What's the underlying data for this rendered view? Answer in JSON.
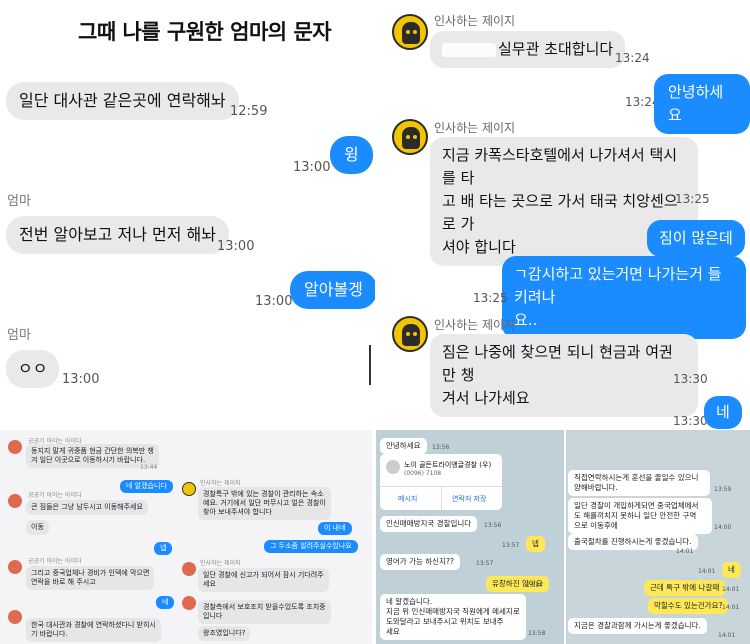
{
  "left_top": {
    "title": "그때 나를 구원한 엄마의 문자",
    "messages": [
      {
        "text": "일단 대사관 같은곳에 연락해놔",
        "time": "12:59"
      },
      {
        "text": "윙",
        "time": "13:00"
      },
      {
        "sender": "엄마",
        "text": "전번 알아보고 저나 먼저 해놔",
        "time": "13:00"
      },
      {
        "text": "알아볼겡",
        "time": "13:00"
      },
      {
        "sender": "엄마",
        "text": "ㅇㅇ",
        "time": "13:00"
      }
    ]
  },
  "right_top": {
    "sender_name": "인사하는 제이지",
    "messages": [
      {
        "text": "실무관 초대합니다",
        "time": "13:24"
      },
      {
        "text": "안녕하세요",
        "time": "13:24"
      },
      {
        "text_lines": [
          "지금 카폭스타호텔에서 나가셔서 택시를 타",
          "고 배 타는 곳으로 가서 태국 치앙센으로 가",
          "셔야 합니다"
        ],
        "time": "13:25"
      },
      {
        "text": "짐이 많은데",
        "time": ""
      },
      {
        "text_lines": [
          "ㄱ감시하고 있는거면 나가는거 들키려나",
          "요.."
        ],
        "time": "13:25"
      },
      {
        "text_lines": [
          "짐은 나중에 찾으면 되니 현금과 여권만 챙",
          "겨서 나가세요"
        ],
        "time": "13:30"
      },
      {
        "text": "네",
        "time": "13:30"
      }
    ]
  },
  "left_bottom": {
    "items": [
      {
        "name": "공공기 아이는 아이다",
        "text_lines": [
          "동지지 말게 귀중품 현금 간단한 의복만 챙",
          "겨 일단 이곳으로 이동하시기 바랍니다."
        ],
        "time": "13:44"
      },
      {
        "name": "인사하는 제이지",
        "text_lines": [
          "경찰특구 밖에 있는 경찰이 관리하는 속소",
          "예요. 거기에서 일단 머무시고 얼은 경찰이",
          "찾아 보내주셔야 합니다"
        ]
      },
      {
        "blue": "네 알겠습니다"
      },
      {
        "name": "공공기 아이는 아이다",
        "text_lines": [
          "큰 짐들은 그냥 남두시고 이동해주세요"
        ]
      },
      {
        "blue": "이 내네"
      },
      {
        "text": "이동"
      },
      {
        "blue": "그 두소좀 알려주실수있나요"
      },
      {
        "blue": "넵"
      },
      {
        "name": "공공기 아이는 아이다",
        "text_lines": [
          "그리고 중국업체나 경비가 인덱에 막으면",
          "연락을 바로 해 주시고"
        ]
      },
      {
        "name": "인사하는 제이지",
        "text_lines": [
          "일단 경찰에 신고가 되어서 잠시 기다려주",
          "세요"
        ]
      },
      {
        "blue": "네"
      },
      {
        "text_lines": [
          "경찰측에서 보호조치 받을수있도록 조치중",
          "입니다"
        ]
      },
      {
        "text": "왕조였입니다?"
      },
      {
        "text_lines": [
          "한국 대사관과 경찰에 연락하셨다니 받히시",
          "기 바랍니다."
        ]
      }
    ]
  },
  "right_bottom": {
    "items": [
      {
        "text": "안녕하세요",
        "time": "13:56"
      },
      {
        "card_title": "노이 골든트라이앵글경찰 (우)",
        "card_sub": "(0096) 7108",
        "btn1": "메시지",
        "btn2": "연락처 저장"
      },
      {
        "text": "인신매매방지국 경찰입니다",
        "time": "13:56"
      },
      {
        "yellow": "넵",
        "time": "13:57"
      },
      {
        "text": "영어가 가능 하신지??",
        "time": "13:57"
      },
      {
        "yellow": "유창하진 않아요",
        "time": "13:57"
      },
      {
        "text_lines": [
          "네 알겠습니다.",
          "지금 위 인신매매방지국 직원에게 메세지로",
          "도와달라고 보내주시고 위치도 보내주",
          "세요"
        ],
        "time": "13:58"
      },
      {
        "text_lines": [
          "직접연락하시는게 훈선을 줄일수 있으니",
          "양해바랍니다."
        ],
        "time": "13:59"
      },
      {
        "text_lines": [
          "일단 경찰이 개입하게되면 중국업체에서",
          "도 해를끼치지 못하니 일단 안전한 구역",
          "으로 이동후에"
        ],
        "time": "14:00"
      },
      {
        "text": "출국절차를 진행하시는게 좋겠습니다.",
        "time": "14:01"
      },
      {
        "yellow": "네",
        "time": "14:01"
      },
      {
        "yellow": "근데 특구 밖에 나갈때",
        "time": "14:01"
      },
      {
        "yellow": "막힐수도 있는건가요?",
        "time": "14:01"
      },
      {
        "text": "지금은 경찰과함께 가시는게 좋겠습니다.",
        "time": "14:01"
      }
    ]
  }
}
